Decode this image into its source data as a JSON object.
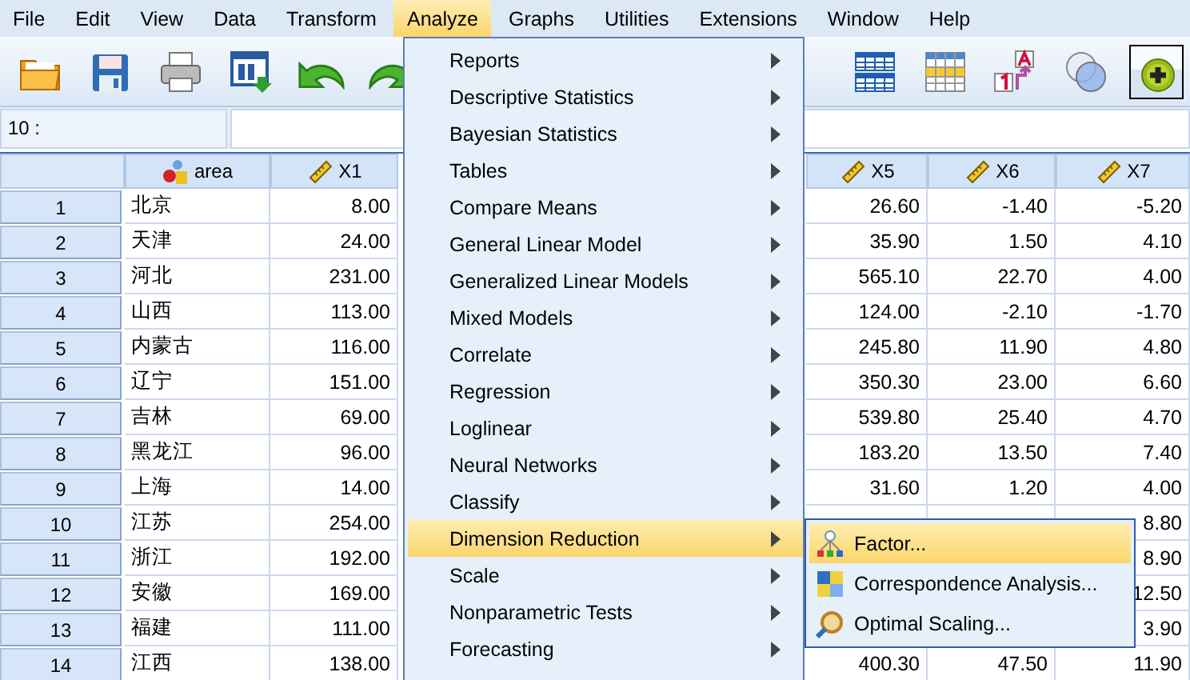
{
  "menu_bar": [
    {
      "label": "File",
      "selected": false
    },
    {
      "label": "Edit",
      "selected": false
    },
    {
      "label": "View",
      "selected": false
    },
    {
      "label": "Data",
      "selected": false
    },
    {
      "label": "Transform",
      "selected": false
    },
    {
      "label": "Analyze",
      "selected": true
    },
    {
      "label": "Graphs",
      "selected": false
    },
    {
      "label": "Utilities",
      "selected": false
    },
    {
      "label": "Extensions",
      "selected": false
    },
    {
      "label": "Window",
      "selected": false
    },
    {
      "label": "Help",
      "selected": false
    }
  ],
  "toolbar": [
    {
      "kind": "open",
      "pressed": false
    },
    {
      "kind": "save",
      "pressed": false
    },
    {
      "kind": "print",
      "pressed": false
    },
    {
      "kind": "recall",
      "pressed": false
    },
    {
      "kind": "undo",
      "pressed": false
    },
    {
      "kind": "redo",
      "pressed": false
    },
    {
      "kind": "split",
      "pressed": false
    },
    {
      "kind": "grid",
      "pressed": false
    },
    {
      "kind": "labels",
      "pressed": false
    },
    {
      "kind": "sets",
      "pressed": false
    },
    {
      "kind": "add",
      "pressed": true
    }
  ],
  "cell_editor": {
    "reference": "10 :"
  },
  "grid": {
    "columns": [
      {
        "name": "area",
        "kind": "string"
      },
      {
        "name": "X1",
        "kind": "scale"
      },
      {
        "name": "X5",
        "kind": "scale"
      },
      {
        "name": "X6",
        "kind": "scale"
      },
      {
        "name": "X7",
        "kind": "scale"
      }
    ],
    "rows": [
      {
        "number": "1",
        "cells": [
          "北京",
          "8.00",
          "26.60",
          "-1.40",
          "-5.20"
        ]
      },
      {
        "number": "2",
        "cells": [
          "天津",
          "24.00",
          "35.90",
          "1.50",
          "4.10"
        ]
      },
      {
        "number": "3",
        "cells": [
          "河北",
          "231.00",
          "565.10",
          "22.70",
          "4.00"
        ]
      },
      {
        "number": "4",
        "cells": [
          "山西",
          "113.00",
          "124.00",
          "-2.10",
          "-1.70"
        ]
      },
      {
        "number": "5",
        "cells": [
          "内蒙古",
          "116.00",
          "245.80",
          "11.90",
          "4.80"
        ]
      },
      {
        "number": "6",
        "cells": [
          "辽宁",
          "151.00",
          "350.30",
          "23.00",
          "6.60"
        ]
      },
      {
        "number": "7",
        "cells": [
          "吉林",
          "69.00",
          "539.80",
          "25.40",
          "4.70"
        ]
      },
      {
        "number": "8",
        "cells": [
          "黑龙江",
          "96.00",
          "183.20",
          "13.50",
          "7.40"
        ]
      },
      {
        "number": "9",
        "cells": [
          "上海",
          "14.00",
          "31.60",
          "1.20",
          "4.00"
        ]
      },
      {
        "number": "10",
        "cells": [
          "江苏",
          "254.00",
          null,
          null,
          "8.80"
        ]
      },
      {
        "number": "11",
        "cells": [
          "浙江",
          "192.00",
          null,
          null,
          "8.90"
        ]
      },
      {
        "number": "12",
        "cells": [
          "安徽",
          "169.00",
          null,
          null,
          "12.50"
        ]
      },
      {
        "number": "13",
        "cells": [
          "福建",
          "111.00",
          null,
          null,
          "3.90"
        ]
      },
      {
        "number": "14",
        "cells": [
          "江西",
          "138.00",
          "400.30",
          "47.50",
          "11.90"
        ]
      }
    ]
  },
  "analyze_menu": [
    {
      "label": "Reports",
      "selected": false
    },
    {
      "label": "Descriptive Statistics",
      "selected": false
    },
    {
      "label": "Bayesian Statistics",
      "selected": false
    },
    {
      "label": "Tables",
      "selected": false
    },
    {
      "label": "Compare Means",
      "selected": false
    },
    {
      "label": "General Linear Model",
      "selected": false
    },
    {
      "label": "Generalized Linear Models",
      "selected": false
    },
    {
      "label": "Mixed Models",
      "selected": false
    },
    {
      "label": "Correlate",
      "selected": false
    },
    {
      "label": "Regression",
      "selected": false
    },
    {
      "label": "Loglinear",
      "selected": false
    },
    {
      "label": "Neural Networks",
      "selected": false
    },
    {
      "label": "Classify",
      "selected": false
    },
    {
      "label": "Dimension Reduction",
      "selected": true
    },
    {
      "label": "Scale",
      "selected": false
    },
    {
      "label": "Nonparametric Tests",
      "selected": false
    },
    {
      "label": "Forecasting",
      "selected": false
    }
  ],
  "submenu": [
    {
      "label": "Factor...",
      "kind": "factor",
      "selected": true
    },
    {
      "label": "Correspondence Analysis...",
      "kind": "correspondence",
      "selected": false
    },
    {
      "label": "Optimal Scaling...",
      "kind": "optimal",
      "selected": false
    }
  ]
}
